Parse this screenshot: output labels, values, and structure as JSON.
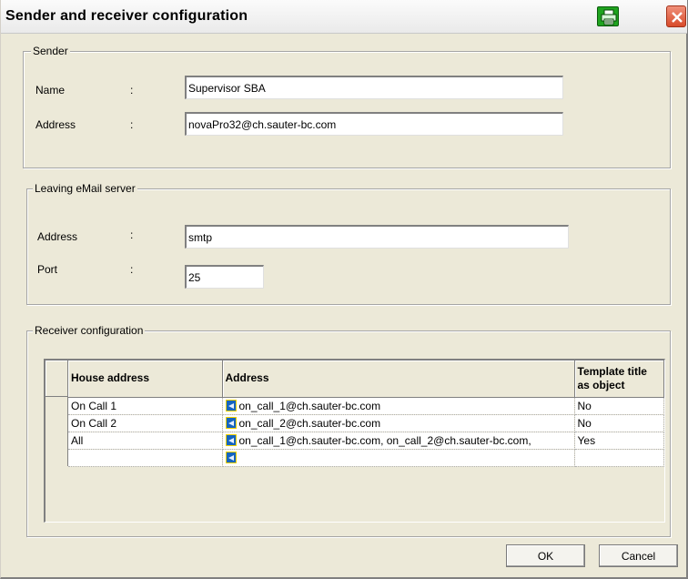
{
  "window": {
    "title": "Sender and receiver configuration"
  },
  "icons": {
    "print": "printer-icon",
    "close": "close-icon",
    "address_book": "address-book-icon"
  },
  "sender": {
    "legend": "Sender",
    "name_label": "Name",
    "name_colon": ":",
    "name_value": "Supervisor SBA",
    "address_label": "Address",
    "address_colon": ":",
    "address_value": "novaPro32@ch.sauter-bc.com"
  },
  "mail_server": {
    "legend": "Leaving eMail server",
    "address_label": "Address",
    "address_colon": ":",
    "address_value": "smtp",
    "port_label": "Port",
    "port_colon": ":",
    "port_value": "25"
  },
  "receiver": {
    "legend": "Receiver configuration",
    "columns": [
      "House address",
      "Address",
      "Template title as object"
    ],
    "rows": [
      {
        "house": "On Call 1",
        "address": "on_call_1@ch.sauter-bc.com",
        "template": "No"
      },
      {
        "house": "On Call 2",
        "address": "on_call_2@ch.sauter-bc.com",
        "template": "No"
      },
      {
        "house": "All",
        "address": "on_call_1@ch.sauter-bc.com, on_call_2@ch.sauter-bc.com,",
        "template": "Yes"
      },
      {
        "house": "",
        "address": "",
        "template": ""
      }
    ]
  },
  "buttons": {
    "ok": "OK",
    "cancel": "Cancel"
  },
  "colors": {
    "dialog_bg": "#ece9d8",
    "print_button": "#1fa31f",
    "close_button": "#d84b2a",
    "address_icon": "#1565c0"
  }
}
